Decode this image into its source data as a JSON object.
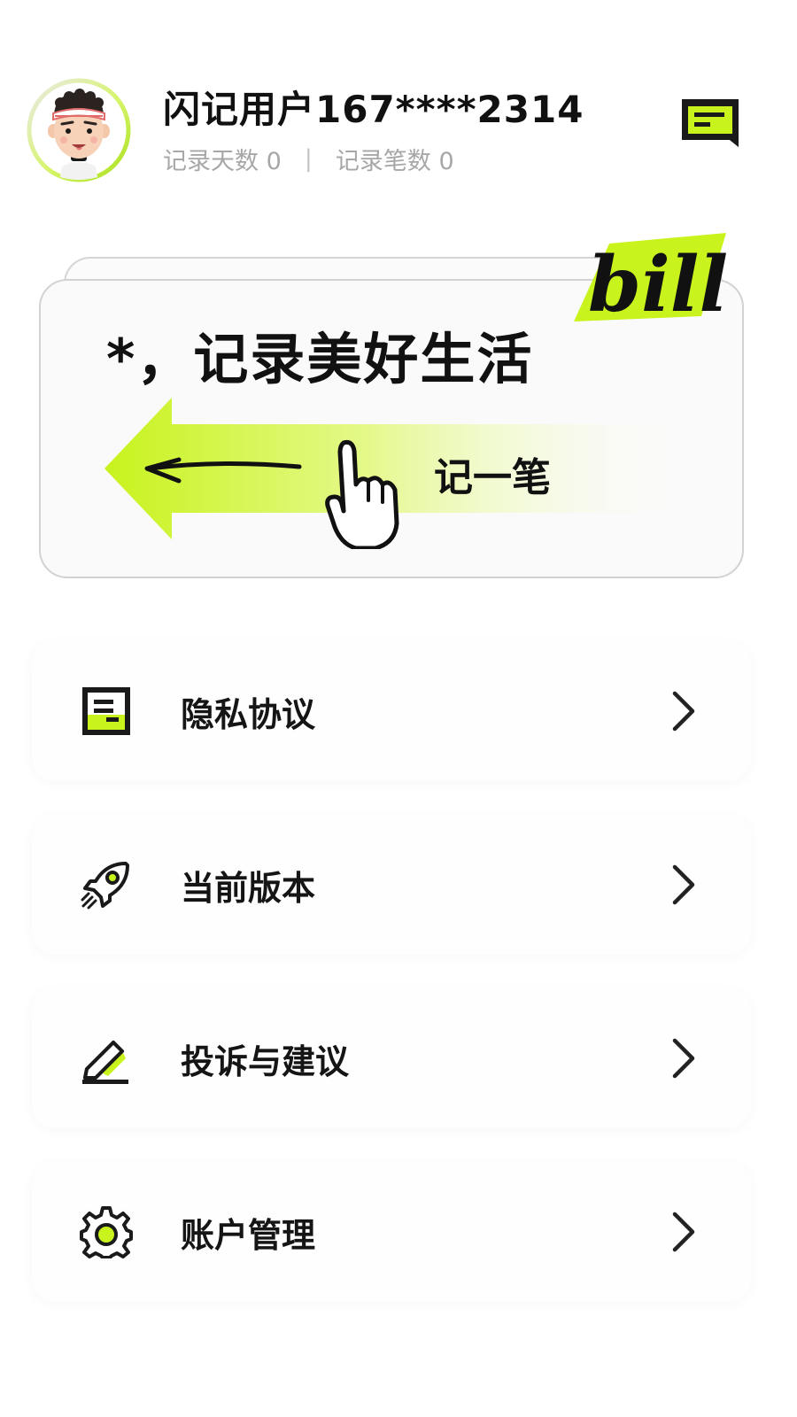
{
  "header": {
    "user_name": "闪记用户167****2314",
    "stats": {
      "days_label": "记录天数 0",
      "separator": "|",
      "entries_label": "记录笔数 0"
    },
    "message_icon": "message-icon"
  },
  "banner": {
    "slogan": "*，记录美好生活",
    "badge_text": "bill",
    "action_label": "记一笔",
    "accent_color": "#C8F31D"
  },
  "menu": {
    "items": [
      {
        "label": "隐私协议",
        "icon": "document-icon"
      },
      {
        "label": "当前版本",
        "icon": "rocket-icon"
      },
      {
        "label": "投诉与建议",
        "icon": "pencil-icon"
      },
      {
        "label": "账户管理",
        "icon": "gear-icon"
      }
    ]
  },
  "colors": {
    "accent": "#C8F31D",
    "text": "#111111",
    "muted": "#A7A7A7"
  }
}
